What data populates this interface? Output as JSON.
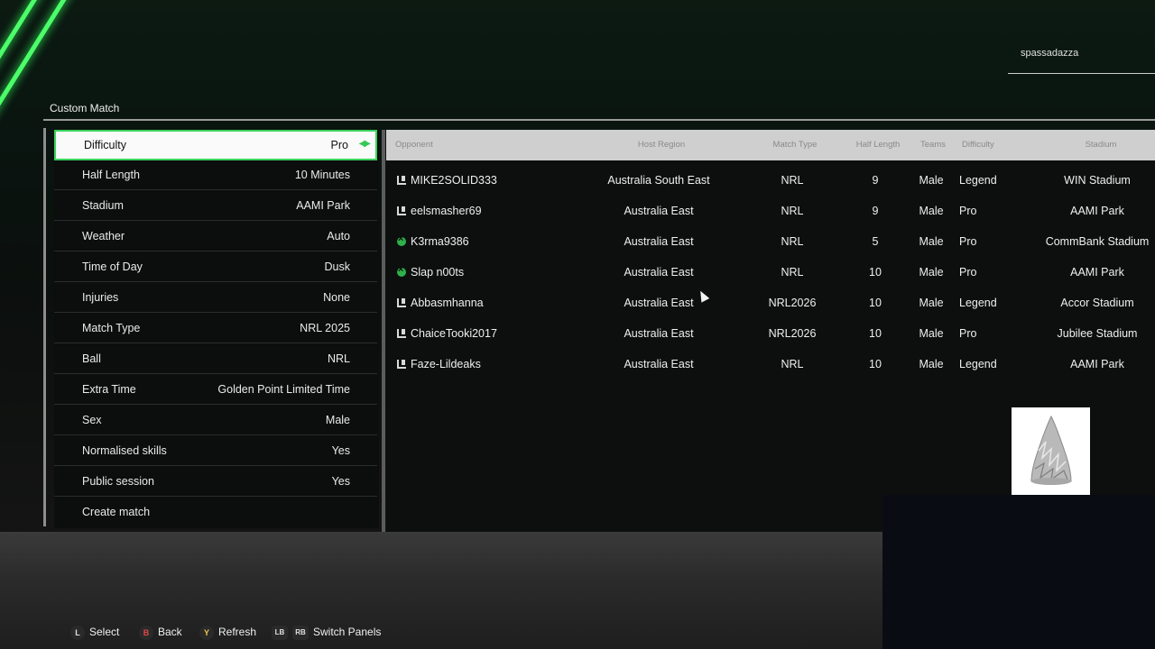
{
  "user": {
    "gamertag": "spassadazza"
  },
  "page": {
    "title": "Custom Match"
  },
  "settings": [
    {
      "label": "Difficulty",
      "value": "Pro"
    },
    {
      "label": "Half Length",
      "value": "10 Minutes"
    },
    {
      "label": "Stadium",
      "value": "AAMI Park"
    },
    {
      "label": "Weather",
      "value": "Auto"
    },
    {
      "label": "Time of Day",
      "value": "Dusk"
    },
    {
      "label": "Injuries",
      "value": "None"
    },
    {
      "label": "Match Type",
      "value": "NRL 2025"
    },
    {
      "label": "Ball",
      "value": "NRL"
    },
    {
      "label": "Extra Time",
      "value": "Golden Point Limited Time"
    },
    {
      "label": "Sex",
      "value": "Male"
    },
    {
      "label": "Normalised skills",
      "value": "Yes"
    },
    {
      "label": "Public session",
      "value": "Yes"
    },
    {
      "label": "Create match",
      "value": ""
    }
  ],
  "lobby": {
    "headers": {
      "opponent": "Opponent",
      "host_region": "Host Region",
      "match_type": "Match Type",
      "half_length": "Half Length",
      "teams": "Teams",
      "difficulty": "Difficulty",
      "stadium": "Stadium"
    },
    "rows": [
      {
        "platform": "pc-icon",
        "opponent": "MIKE2SOLID333",
        "region": "Australia South East",
        "match_type": "NRL",
        "half_length": "9",
        "teams": "Male",
        "difficulty": "Legend",
        "stadium": "WIN Stadium"
      },
      {
        "platform": "pc-icon",
        "opponent": "eelsmasher69",
        "region": "Australia East",
        "match_type": "NRL",
        "half_length": "9",
        "teams": "Male",
        "difficulty": "Pro",
        "stadium": "AAMI Park"
      },
      {
        "platform": "xbox-icon",
        "opponent": "K3rma9386",
        "region": "Australia East",
        "match_type": "NRL",
        "half_length": "5",
        "teams": "Male",
        "difficulty": "Pro",
        "stadium": "CommBank Stadium"
      },
      {
        "platform": "xbox-icon",
        "opponent": "Slap n00ts",
        "region": "Australia East",
        "match_type": "NRL",
        "half_length": "10",
        "teams": "Male",
        "difficulty": "Pro",
        "stadium": "AAMI Park"
      },
      {
        "platform": "pc-icon",
        "opponent": "Abbasmhanna",
        "region": "Australia East",
        "match_type": "NRL2026",
        "half_length": "10",
        "teams": "Male",
        "difficulty": "Legend",
        "stadium": "Accor Stadium"
      },
      {
        "platform": "pc-icon",
        "opponent": "ChaiceTooki2017",
        "region": "Australia East",
        "match_type": "NRL2026",
        "half_length": "10",
        "teams": "Male",
        "difficulty": "Pro",
        "stadium": "Jubilee Stadium"
      },
      {
        "platform": "pc-icon",
        "opponent": "Faze-Lildeaks",
        "region": "Australia East",
        "match_type": "NRL",
        "half_length": "10",
        "teams": "Male",
        "difficulty": "Legend",
        "stadium": "AAMI Park"
      }
    ]
  },
  "hints": {
    "select_button": "L",
    "select": "Select",
    "back_button": "B",
    "back": "Back",
    "refresh_button": "Y",
    "refresh": "Refresh",
    "lb": "LB",
    "rb": "RB",
    "switch": "Switch Panels"
  },
  "colors": {
    "accent": "#3bd35a",
    "panel": "#0c0e0d",
    "header": "#cfcfcf"
  }
}
